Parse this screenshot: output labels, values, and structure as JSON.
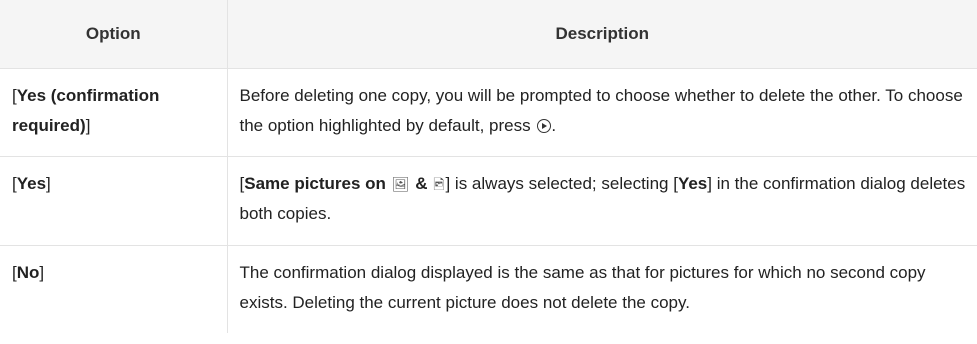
{
  "table": {
    "headers": {
      "option": "Option",
      "description": "Description"
    },
    "rows": [
      {
        "option": {
          "open": "[",
          "label": "Yes (confirmation required)",
          "close": "]"
        },
        "description": {
          "text": "Before deleting one copy, you will be prompted to choose whether to delete the other. To choose the option highlighted by default, press",
          "end": "."
        }
      },
      {
        "option": {
          "open": "[",
          "label": "Yes",
          "close": "]"
        },
        "description": {
          "part1": "[",
          "bold1": "Same pictures on",
          "icon1": "card-slot-1-icon",
          "amp": "&",
          "icon2": "card-slot-2-icon",
          "part2": "] is always selected; selecting [",
          "bold2": "Yes",
          "part3": "] in the confirmation dialog deletes both copies."
        }
      },
      {
        "option": {
          "open": "[",
          "label": "No",
          "close": "]"
        },
        "description": {
          "text": "The confirmation dialog displayed is the same as that for pictures for which no second copy exists. Deleting the current picture does not delete the copy."
        }
      }
    ]
  },
  "icons": {
    "multi_selector_right": "multi-selector-right-icon"
  }
}
